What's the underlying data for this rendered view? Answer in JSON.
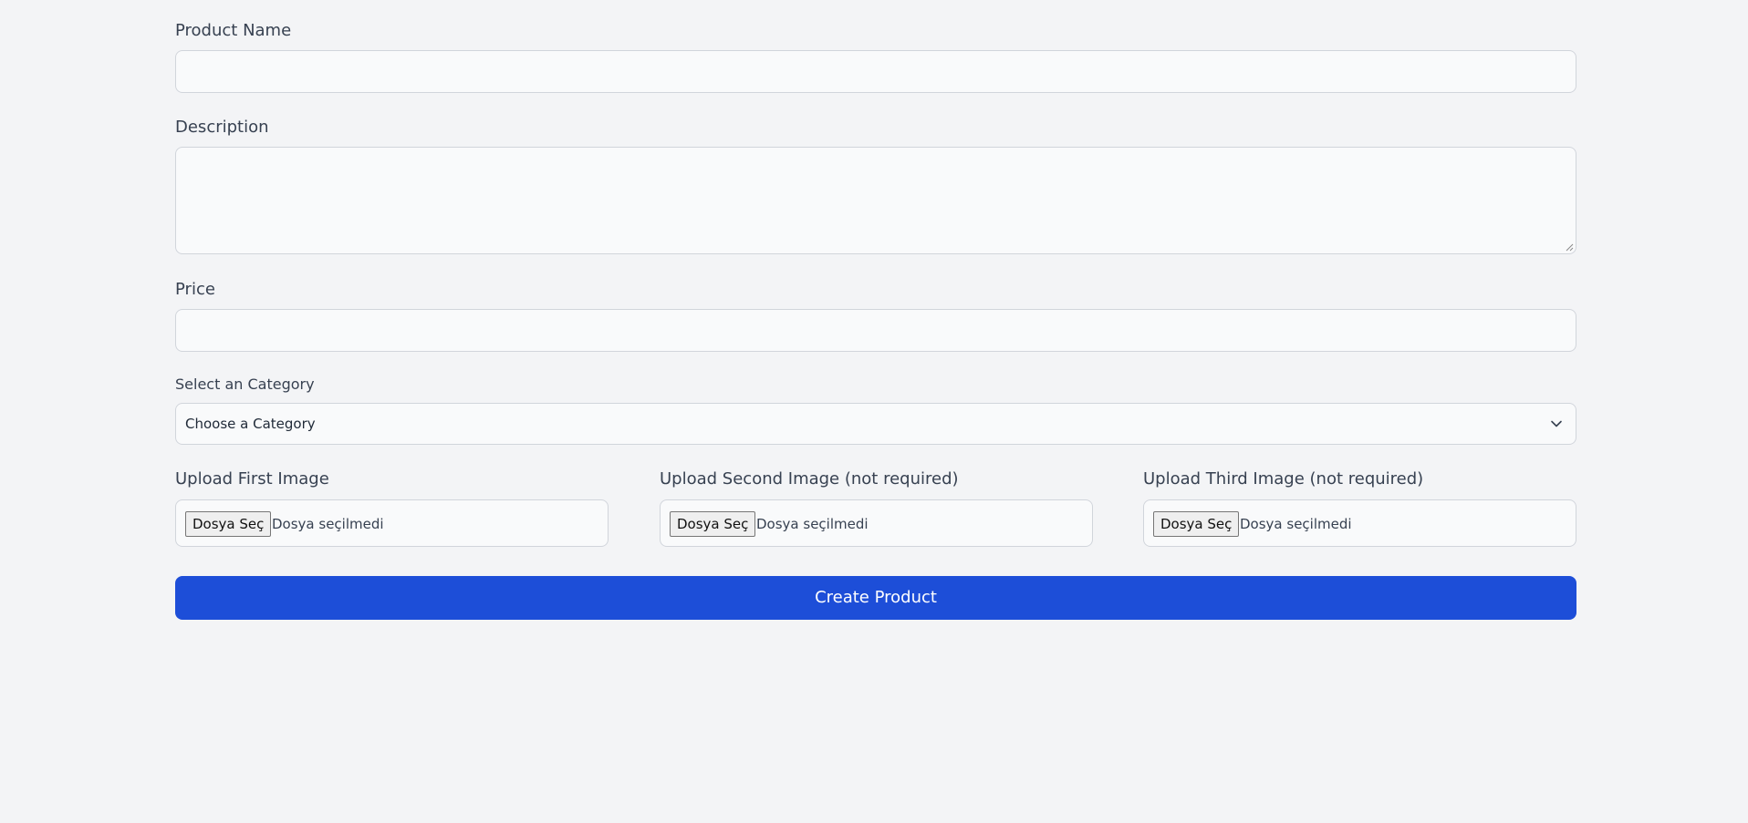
{
  "form": {
    "product_name": {
      "label": "Product Name",
      "value": ""
    },
    "description": {
      "label": "Description",
      "value": ""
    },
    "price": {
      "label": "Price",
      "value": ""
    },
    "category": {
      "label": "Select an Category",
      "selected": "Choose a Category"
    },
    "uploads": [
      {
        "label": "Upload First Image",
        "button_label": "Dosya Seç",
        "status": "Dosya seçilmedi"
      },
      {
        "label": "Upload Second Image (not required)",
        "button_label": "Dosya Seç",
        "status": "Dosya seçilmedi"
      },
      {
        "label": "Upload Third Image (not required)",
        "button_label": "Dosya Seç",
        "status": "Dosya seçilmedi"
      }
    ],
    "submit_label": "Create Product"
  },
  "colors": {
    "background": "#f3f4f6",
    "input_background": "#f9fafb",
    "border": "#d1d5db",
    "primary": "#1d4ed8"
  },
  "icons": {
    "select_arrow": "chevron-down-icon",
    "textarea_grip": "resize-grip-icon"
  }
}
